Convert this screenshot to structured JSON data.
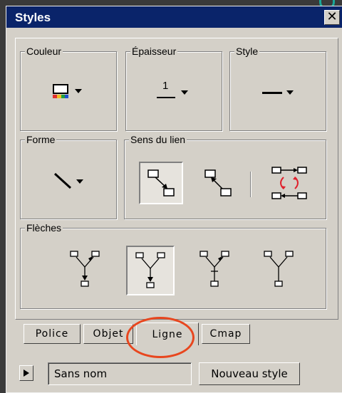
{
  "window": {
    "title": "Styles",
    "close_label": "✕"
  },
  "groups": {
    "couleur": "Couleur",
    "epaisseur": "Épaisseur",
    "style": "Style",
    "forme": "Forme",
    "sens_du_lien": "Sens du lien",
    "fleches": "Flèches"
  },
  "controls": {
    "epaisseur_value": "1",
    "couleur_icon": "color-swatch-icon",
    "style_icon": "solid-line-icon",
    "forme_icon": "diagonal-line-icon",
    "sens_icons": [
      "link-direction-down-right-icon",
      "link-direction-up-left-icon",
      "link-bidirectional-cycle-icon"
    ],
    "sens_selected_index": 0,
    "fleches_icons": [
      "arrows-both-to-center-icon",
      "arrows-converging-down-icon",
      "arrows-heads-up-icon",
      "arrows-none-icon"
    ],
    "fleches_selected_index": 1
  },
  "tabs": [
    "Police",
    "Objet",
    "Ligne",
    "Cmap"
  ],
  "active_tab": "Ligne",
  "footer": {
    "style_name": "Sans nom",
    "new_style_button": "Nouveau style"
  },
  "colors": {
    "title_bar": "#0a246a",
    "window_bg": "#d4d0c8",
    "annotation": "#e8461e",
    "cycle_arrows": "#e0202c"
  }
}
